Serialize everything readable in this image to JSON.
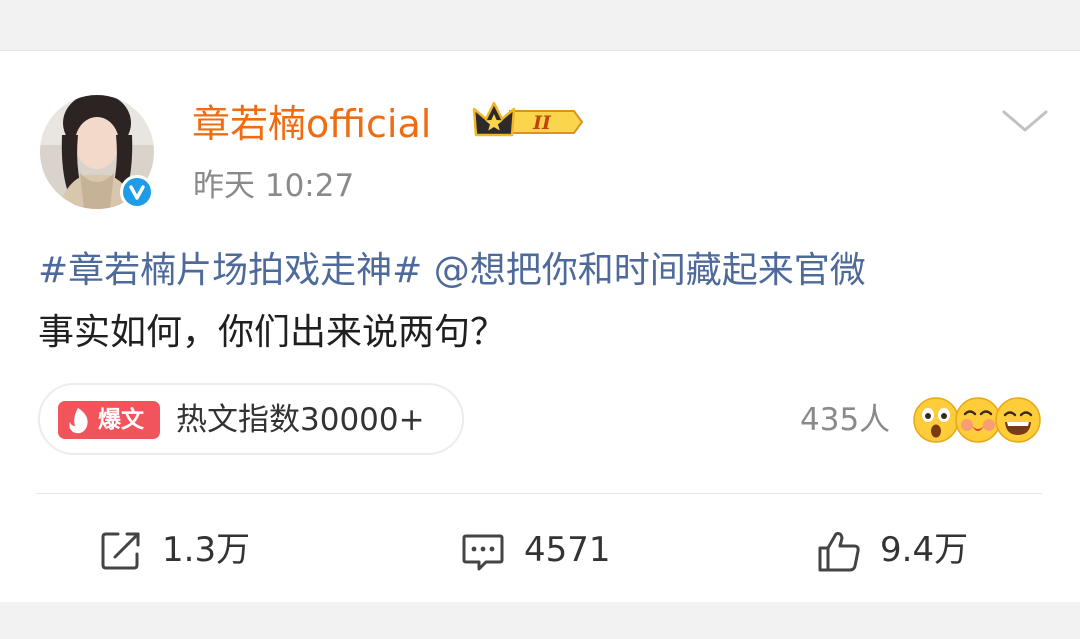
{
  "post": {
    "author": {
      "name": "章若楠official",
      "badge_text": "II",
      "avatar_icon": "avatar-photo",
      "verified_icon": "verified-icon"
    },
    "time": "昨天 10:27",
    "content": {
      "topic": "#章若楠片场拍戏走神#",
      "mention": "@想把你和时间藏起来官微",
      "text": "事实如何，你们出来说两句？"
    },
    "hot": {
      "badge_label": "爆文",
      "text": "热文指数30000+"
    },
    "reactions": {
      "count": "435人",
      "icons": [
        "surprised-emoji",
        "kiss-emoji",
        "grin-emoji"
      ]
    },
    "actions": {
      "share": "1.3万",
      "comment": "4571",
      "like": "9.4万"
    }
  },
  "colors": {
    "username": "#f06c13",
    "link": "#4e6a9b",
    "hot_badge": "#f2545b",
    "verified": "#1f9ce8"
  }
}
